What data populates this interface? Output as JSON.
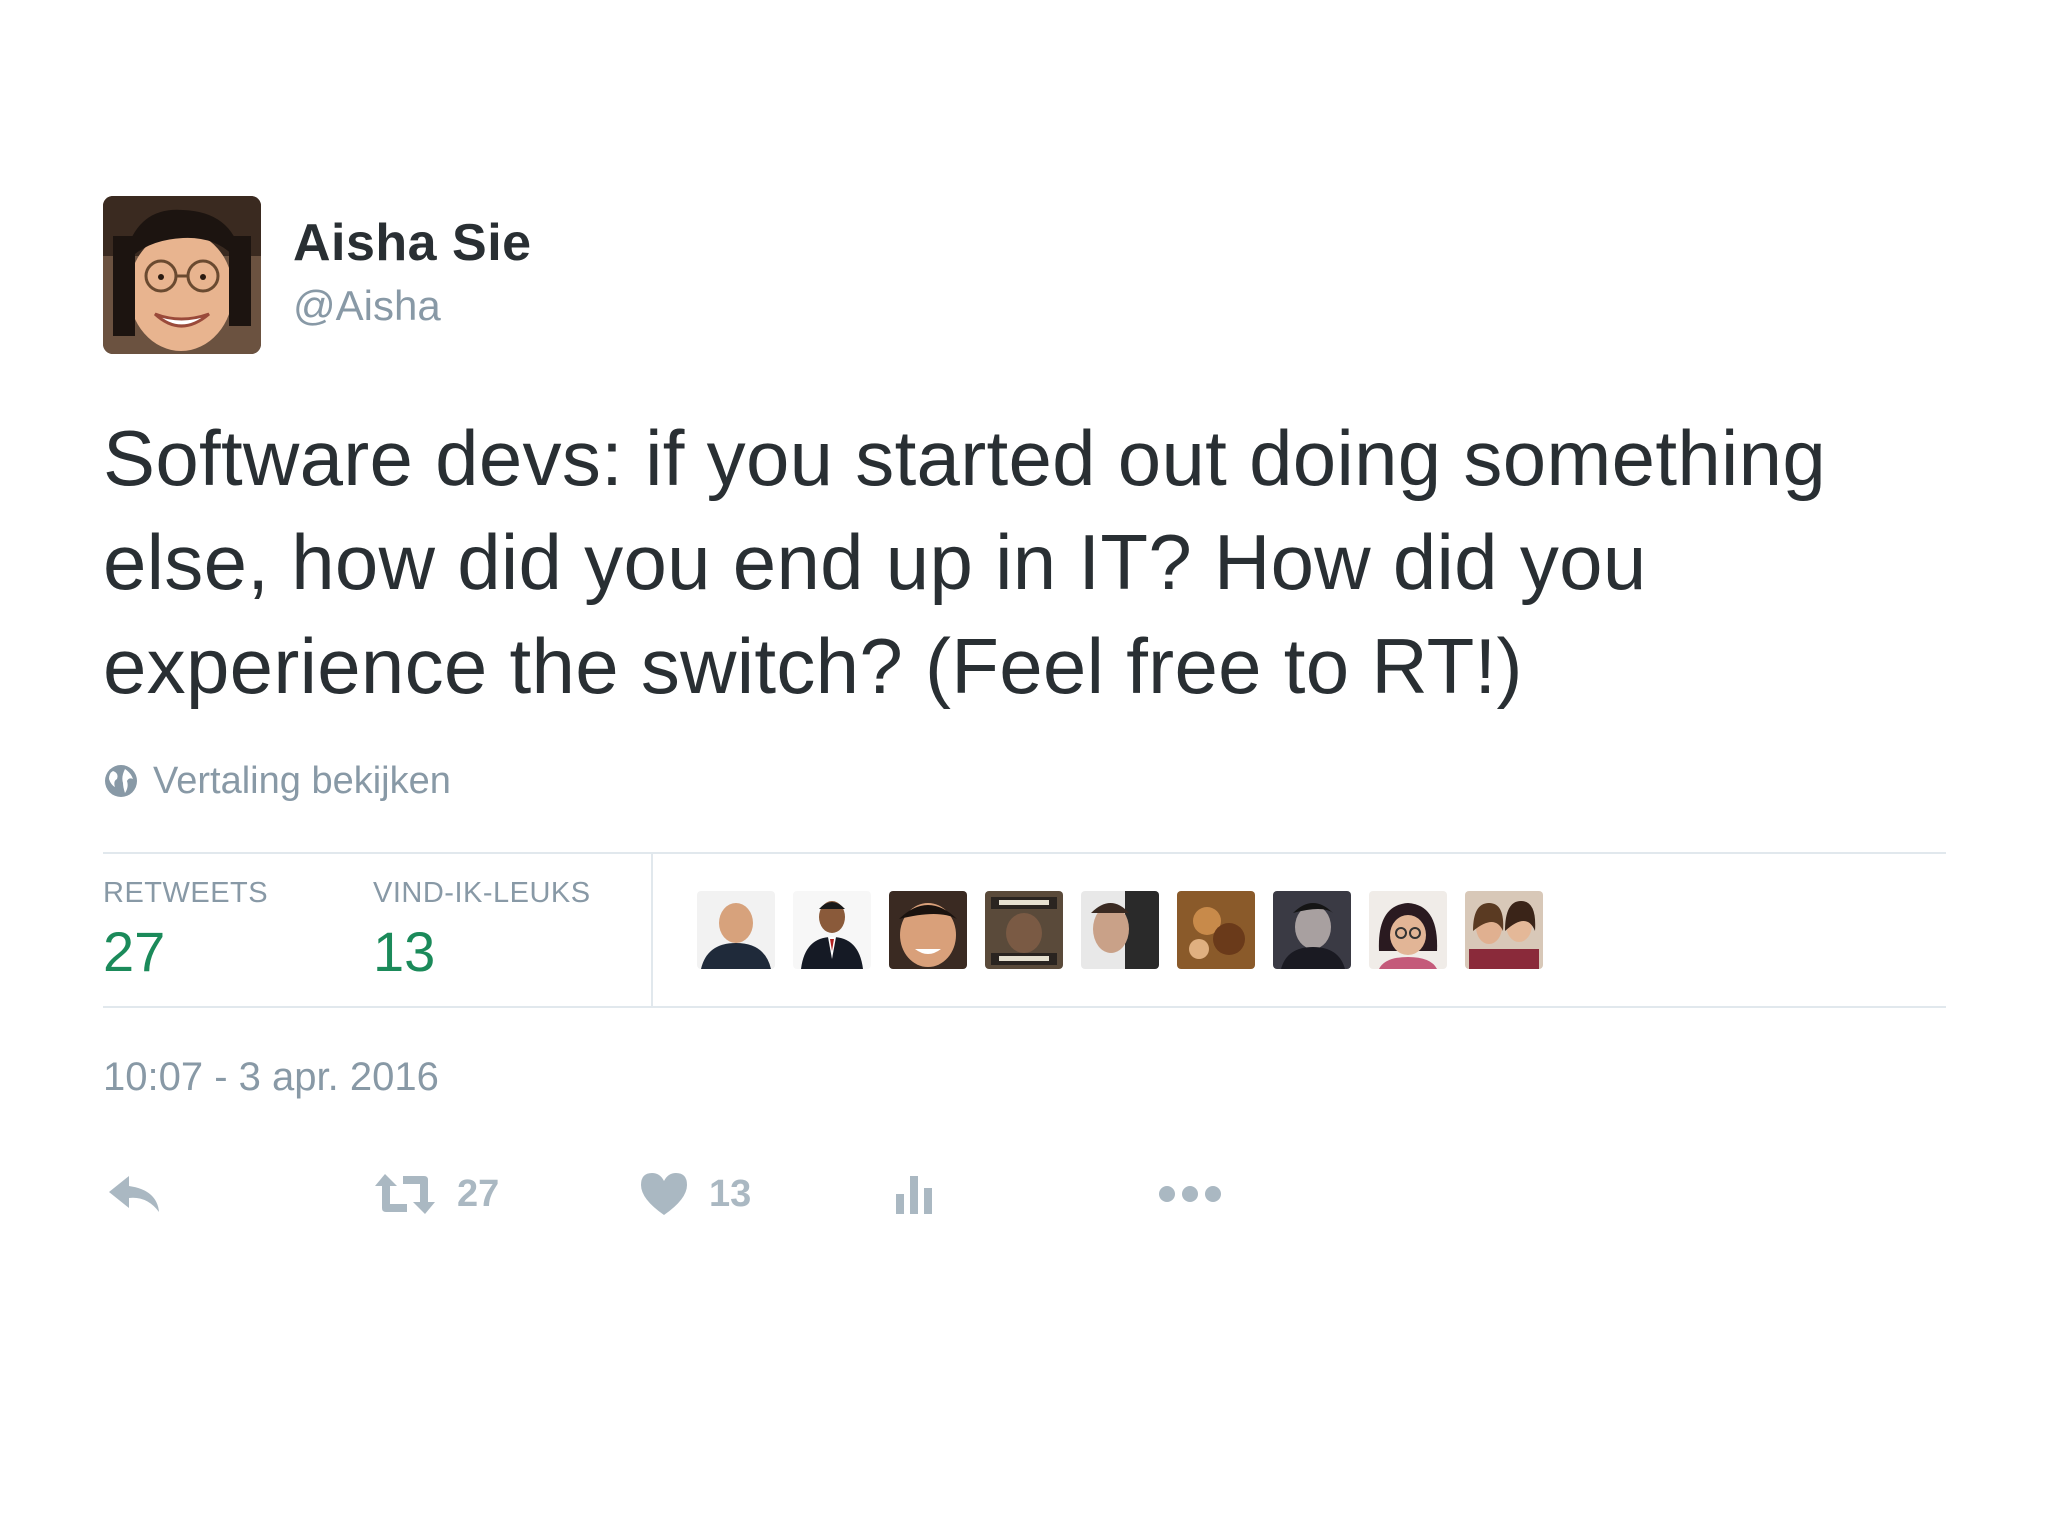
{
  "author": {
    "name": "Aisha Sie",
    "handle": "@Aisha"
  },
  "tweet": {
    "text": "Software devs: if you started out doing something else, how did you end up in IT? How did you experience the switch? (Feel free to RT!)",
    "translate_link": "Vertaling bekijken",
    "timestamp": "10:07 - 3 apr. 2016"
  },
  "stats": {
    "retweets_label": "RETWEETS",
    "retweets_count": "27",
    "likes_label": "VIND-IK-LEUKS",
    "likes_count": "13",
    "liker_avatars": 9
  },
  "actions": {
    "retweet_count": "27",
    "like_count": "13"
  },
  "colors": {
    "count_green": "#1b8a5a",
    "muted": "#8899a6",
    "icon": "#aab8c2",
    "text": "#292f33",
    "divider": "#e1e8ed"
  },
  "icons": {
    "translate": "globe-icon",
    "reply": "reply-icon",
    "retweet": "retweet-icon",
    "like": "heart-icon",
    "analytics": "analytics-icon",
    "more": "more-icon"
  }
}
